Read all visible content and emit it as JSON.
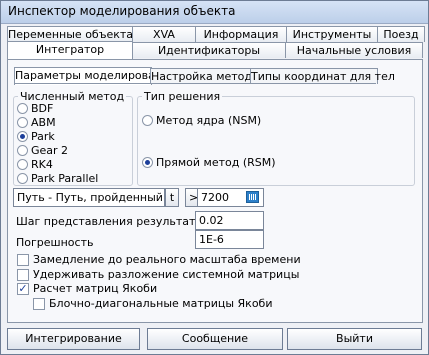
{
  "window": {
    "title": "Инспектор моделирования объекта"
  },
  "tabs_top": [
    "Переменные объекта",
    "XVA",
    "Информация",
    "Инструменты",
    "Поезд"
  ],
  "tabs_bottom": [
    "Интегратор",
    "Идентификаторы",
    "Начальные условия"
  ],
  "active_tab": "Интегратор",
  "subtabs": [
    "Параметры моделирования",
    "Настройка методов",
    "Типы координат для тел"
  ],
  "active_subtab": "Параметры моделирования",
  "numeric_method": {
    "legend": "Численный метод",
    "options": [
      "BDF",
      "ABM",
      "Park",
      "Gear 2",
      "RK4",
      "Park Parallel"
    ],
    "selected": "Park"
  },
  "solution_type": {
    "legend": "Тип решения",
    "options": [
      "Метод ядра (NSM)",
      "Прямой метод (RSM)"
    ],
    "selected": "Прямой метод (RSM)"
  },
  "end_condition": {
    "variable": "Путь - Путь, пройденный",
    "variable_button": "t",
    "operator": ">=",
    "value": "7200"
  },
  "fields": {
    "step_label": "Шаг представления результатов",
    "step_value": "0.02",
    "tolerance_label": "Погрешность",
    "tolerance_value": "1E-6"
  },
  "checkboxes": [
    {
      "label": "Замедление до реального масштаба времени",
      "checked": false
    },
    {
      "label": "Удерживать разложение системной матрицы",
      "checked": false
    },
    {
      "label": "Расчет матриц Якоби",
      "checked": true
    },
    {
      "label": "Блочно-диагональные матрицы Якоби",
      "checked": false
    }
  ],
  "buttons": {
    "integrate": "Интегрирование",
    "message": "Сообщение",
    "exit": "Выйти"
  }
}
